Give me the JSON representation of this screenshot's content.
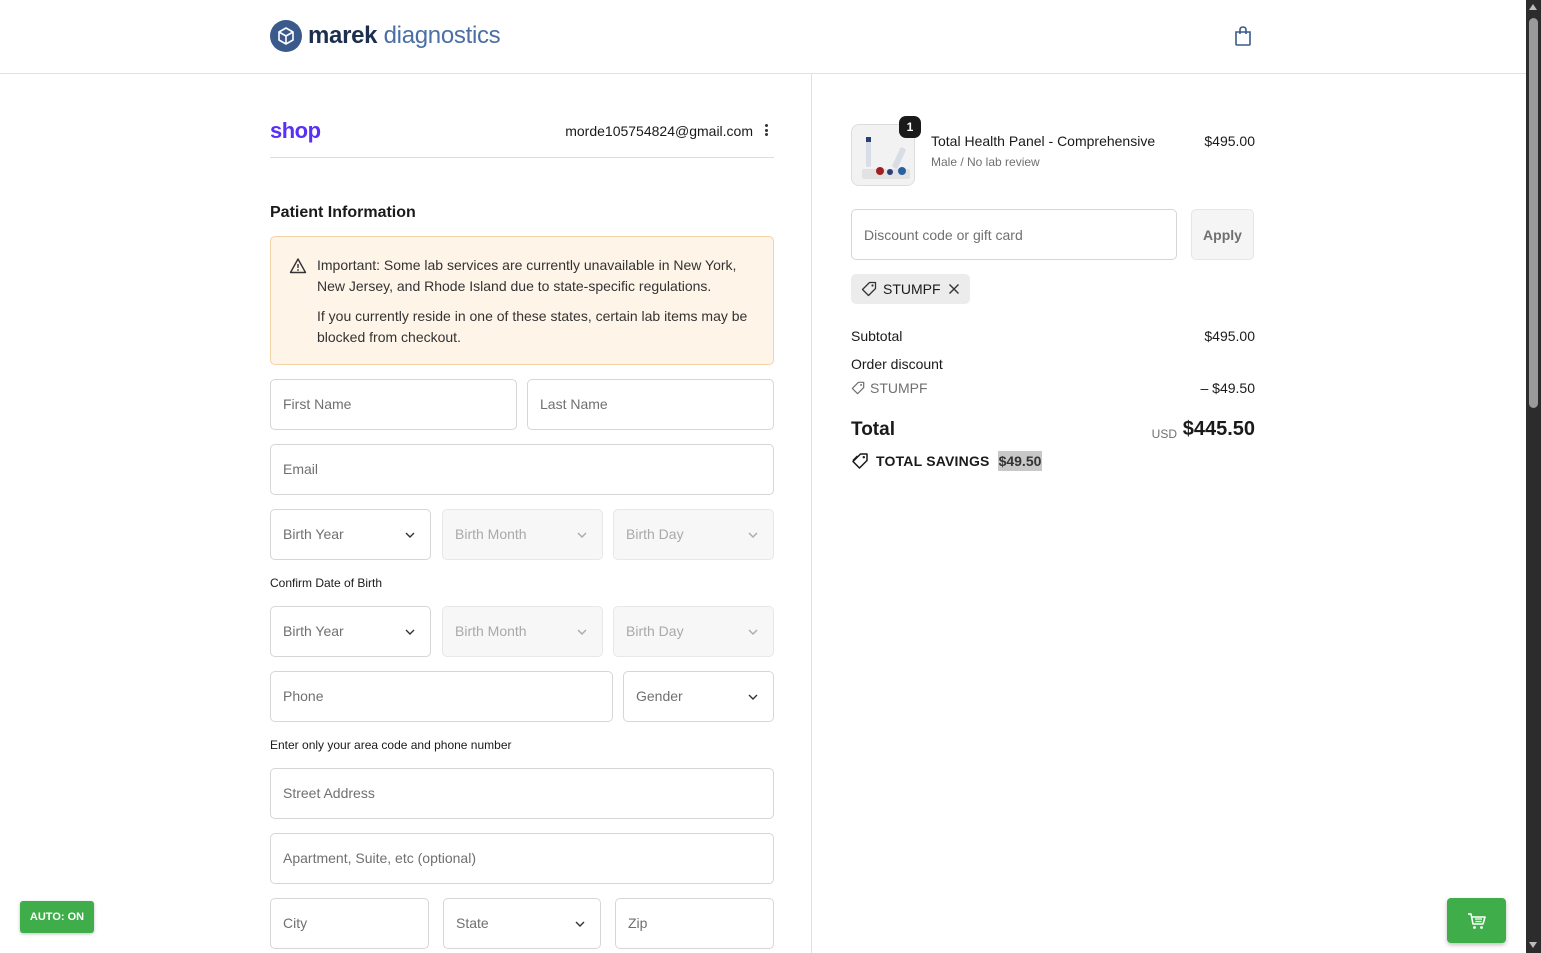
{
  "brand": {
    "name_part1": "marek",
    "name_part2": "diagnostics"
  },
  "header": {
    "cart_icon": "shopping-bag-icon"
  },
  "account": {
    "shop_label": "shop",
    "email": "morde105754824@gmail.com"
  },
  "patient": {
    "title": "Patient Information",
    "notice": {
      "line1": "Important: Some lab services are currently unavailable in New York, New Jersey, and Rhode Island due to state-specific regulations.",
      "line2": "If you currently reside in one of these states, certain lab items may be blocked from checkout."
    },
    "first_name_placeholder": "First Name",
    "last_name_placeholder": "Last Name",
    "email_placeholder": "Email",
    "birth_year": "Birth Year",
    "birth_month": "Birth Month",
    "birth_day": "Birth Day",
    "confirm_dob_label": "Confirm Date of Birth",
    "phone_placeholder": "Phone",
    "gender": "Gender",
    "phone_helper": "Enter only your area code and phone number",
    "street_placeholder": "Street Address",
    "apartment_placeholder": "Apartment, Suite, etc (optional)",
    "city_placeholder": "City",
    "state": "State",
    "zip_placeholder": "Zip"
  },
  "order": {
    "item": {
      "quantity": "1",
      "name": "Total Health Panel - Comprehensive",
      "variant": "Male / No lab review",
      "price": "$495.00"
    },
    "discount_placeholder": "Discount code or gift card",
    "apply_label": "Apply",
    "applied_code": "STUMPF",
    "subtotal_label": "Subtotal",
    "subtotal_value": "$495.00",
    "order_discount_label": "Order discount",
    "discount_code": "STUMPF",
    "discount_value": "– $49.50",
    "total_label": "Total",
    "total_currency": "USD",
    "total_value": "$445.50",
    "savings_label": "TOTAL SAVINGS",
    "savings_value": "$49.50"
  },
  "overlay": {
    "auto_label": "AUTO: ON"
  },
  "colors": {
    "accent_green": "#3fae4a",
    "shop_purple": "#5a31f4",
    "brand_navy": "#1d2f4f",
    "notice_bg": "#fef4e8"
  }
}
